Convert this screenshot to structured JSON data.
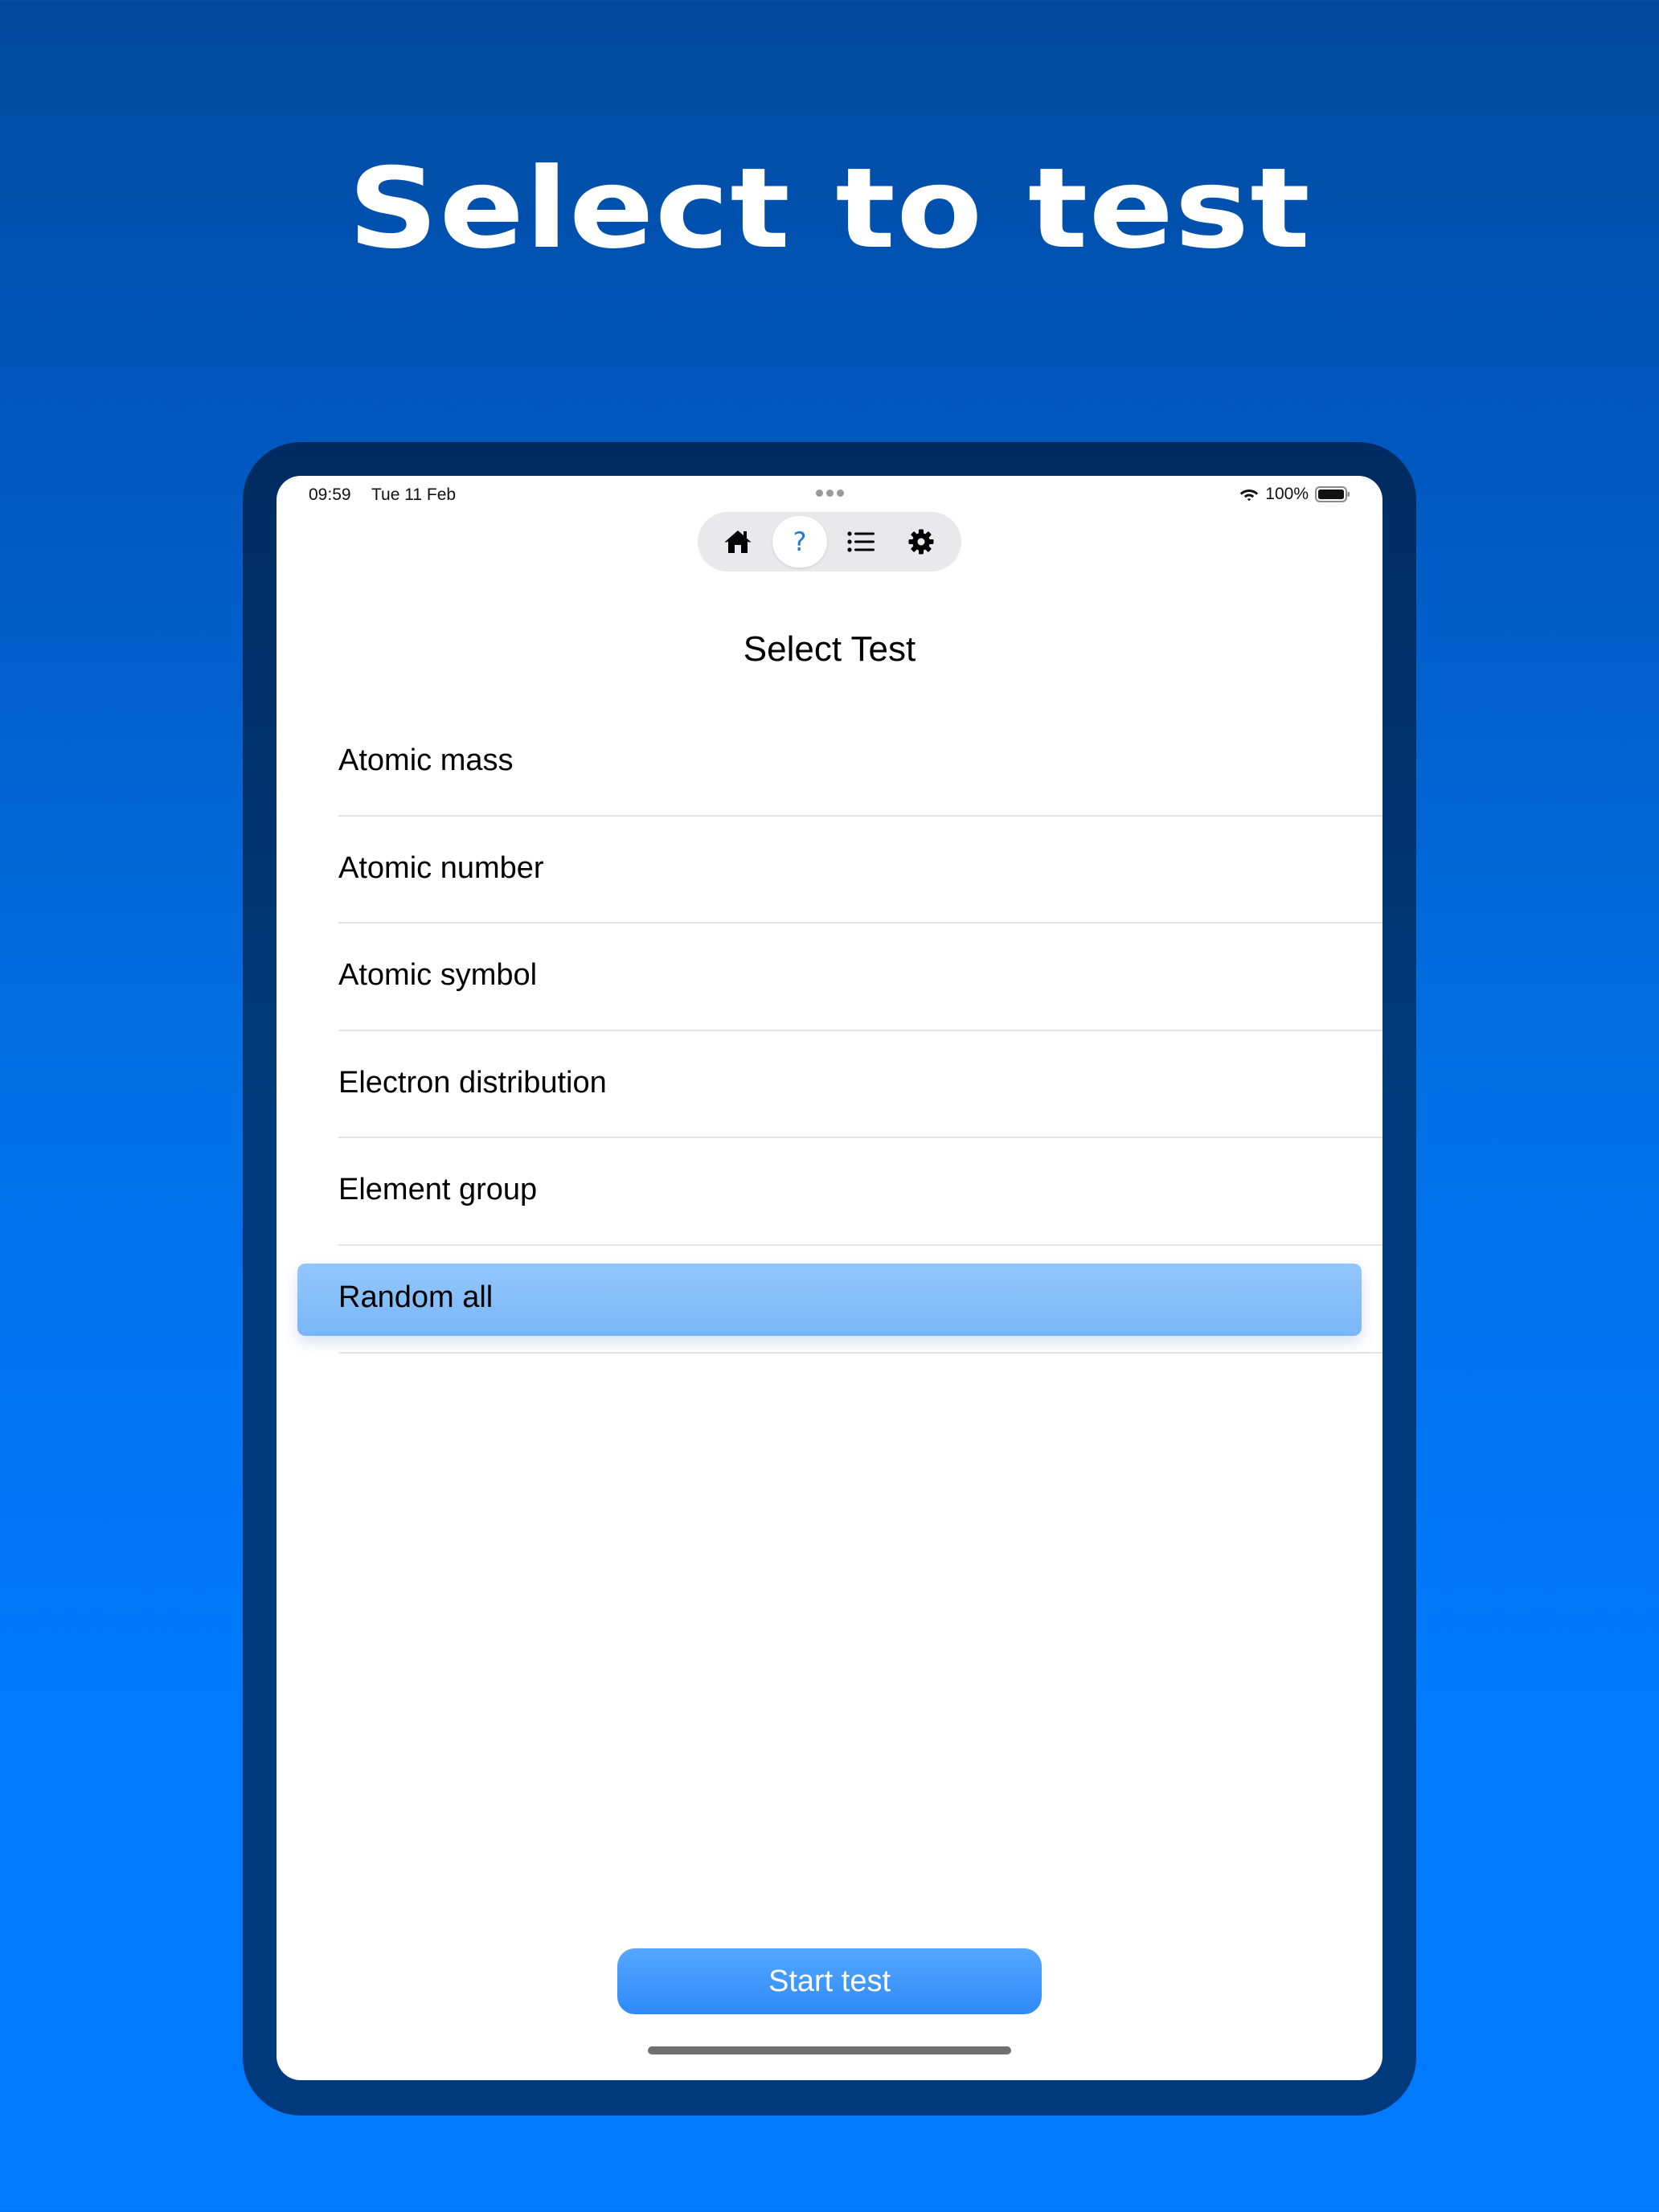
{
  "headline": "Select to test",
  "status_bar": {
    "time": "09:59",
    "date": "Tue 11 Feb",
    "battery": "100%"
  },
  "tab_bar": {
    "items": [
      {
        "id": "home",
        "icon": "house-icon",
        "active": false
      },
      {
        "id": "test",
        "icon": "question-icon",
        "glyph": "?",
        "active": true
      },
      {
        "id": "list",
        "icon": "list-icon",
        "active": false
      },
      {
        "id": "settings",
        "icon": "gear-icon",
        "active": false
      }
    ],
    "active_color": "#1f7ae0"
  },
  "main": {
    "title": "Select Test",
    "tests": [
      {
        "label": "Atomic mass",
        "selected": false
      },
      {
        "label": "Atomic number",
        "selected": false
      },
      {
        "label": "Atomic symbol",
        "selected": false
      },
      {
        "label": "Electron distribution",
        "selected": false
      },
      {
        "label": "Element group",
        "selected": false
      },
      {
        "label": "Random all",
        "selected": true
      }
    ],
    "start_button": "Start test"
  },
  "colors": {
    "accent": "#007aff",
    "selected_row": "#8ec3fc",
    "button": "#3d95fb"
  }
}
